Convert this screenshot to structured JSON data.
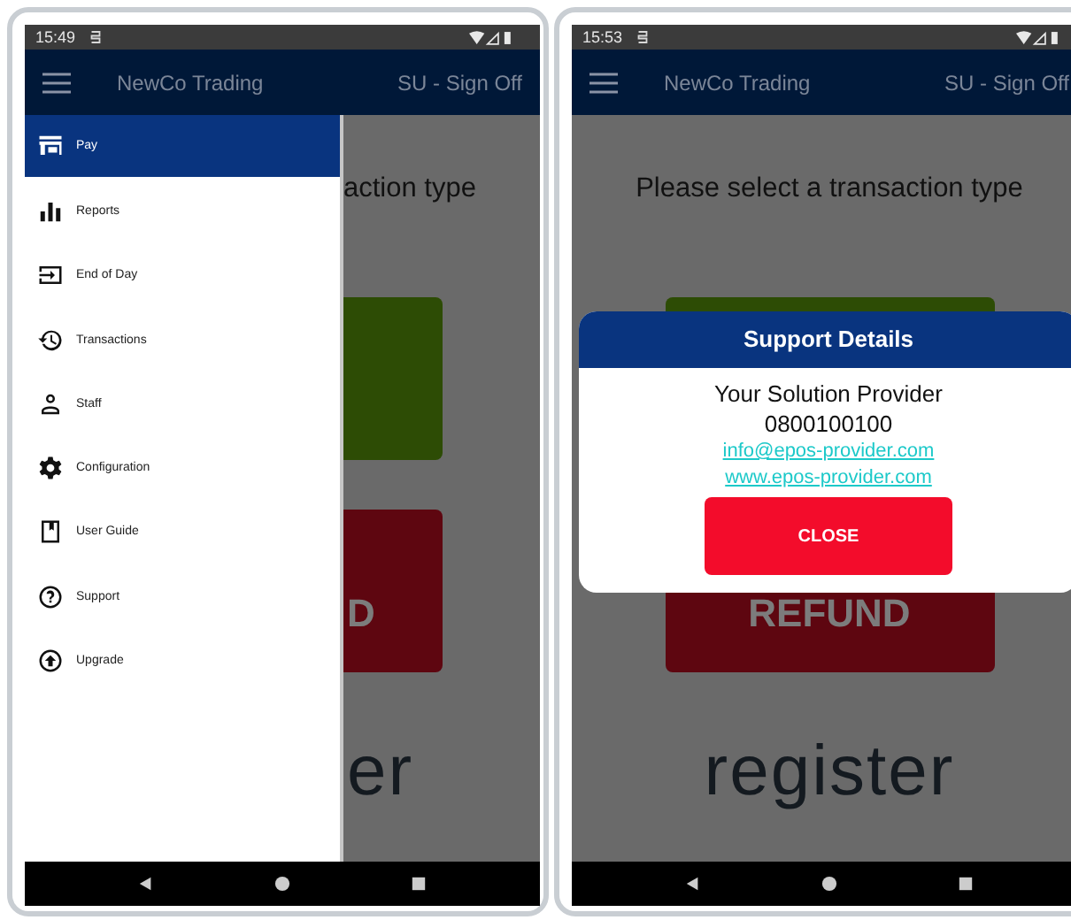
{
  "phones": [
    {
      "status_bar": {
        "time": "15:49"
      },
      "app_bar": {
        "title": "NewCo Trading",
        "account": "SU - Sign Off"
      },
      "screen": {
        "prompt": "action type",
        "refund_button": "D",
        "logo": "er"
      },
      "drawer": {
        "items": [
          {
            "label": "Pay",
            "kind": "store",
            "selected": true
          },
          {
            "label": "Reports",
            "kind": "chart",
            "selected": false
          },
          {
            "label": "End of Day",
            "kind": "exit",
            "selected": false
          },
          {
            "label": "Transactions",
            "kind": "history",
            "selected": false
          },
          {
            "label": "Staff",
            "kind": "person",
            "selected": false
          },
          {
            "label": "Configuration",
            "kind": "gear",
            "selected": false
          },
          {
            "label": "User Guide",
            "kind": "book",
            "selected": false
          },
          {
            "label": "Support",
            "kind": "help",
            "selected": false
          },
          {
            "label": "Upgrade",
            "kind": "upgrade",
            "selected": false
          }
        ]
      }
    },
    {
      "status_bar": {
        "time": "15:53"
      },
      "app_bar": {
        "title": "NewCo Trading",
        "account": "SU - Sign Off"
      },
      "screen": {
        "prompt": "Please select a transaction type",
        "refund_button": "REFUND",
        "logo": "register"
      },
      "dialog": {
        "title": "Support Details",
        "lines": [
          "Your Solution Provider",
          "0800100100"
        ],
        "links": [
          "info@epos-provider.com",
          "www.epos-provider.com"
        ],
        "button": "CLOSE"
      }
    }
  ]
}
